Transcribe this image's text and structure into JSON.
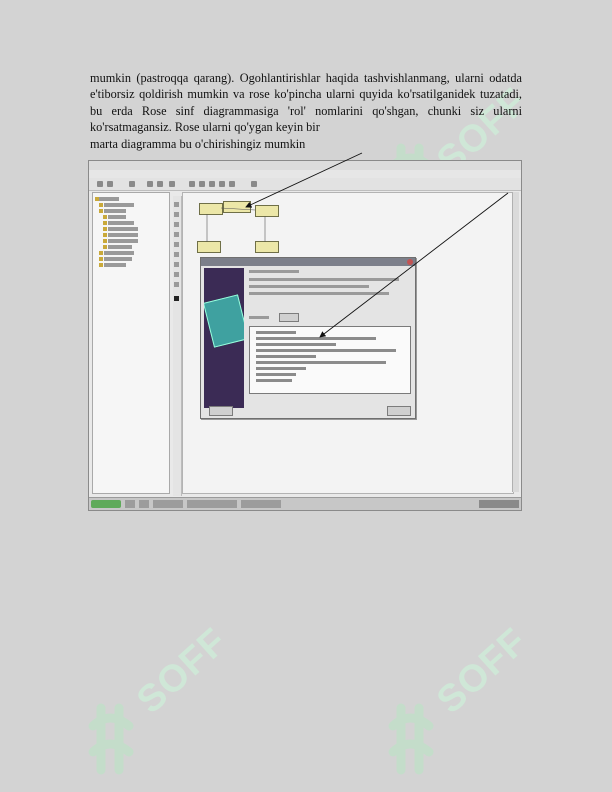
{
  "document": {
    "paragraph_lines": [
      "mumkin (pastroqqa qarang). Ogohlantirishlar haqida tashvishlanmang,",
      "ularni odatda e'tiborsiz qoldirish mumkin va rose ko'pincha ularni quyida",
      "ko'rsatilganidek tuzatadi, bu erda Rose sinf diagrammasiga 'rol' nomlarini",
      "qo'shgan, chunki siz ularni ko'rsatmagansiz. Rose ularni qo'ygan keyin bir",
      "marta diagramma bu o'chirishingiz mumkin"
    ]
  },
  "watermark": {
    "brand": "SOFF",
    "color": "#b9e6c4"
  },
  "screenshot": {
    "accent": "#5faa5a",
    "dialog_title_color": "#7c7f8a",
    "class_fill": "#ece7a8"
  }
}
